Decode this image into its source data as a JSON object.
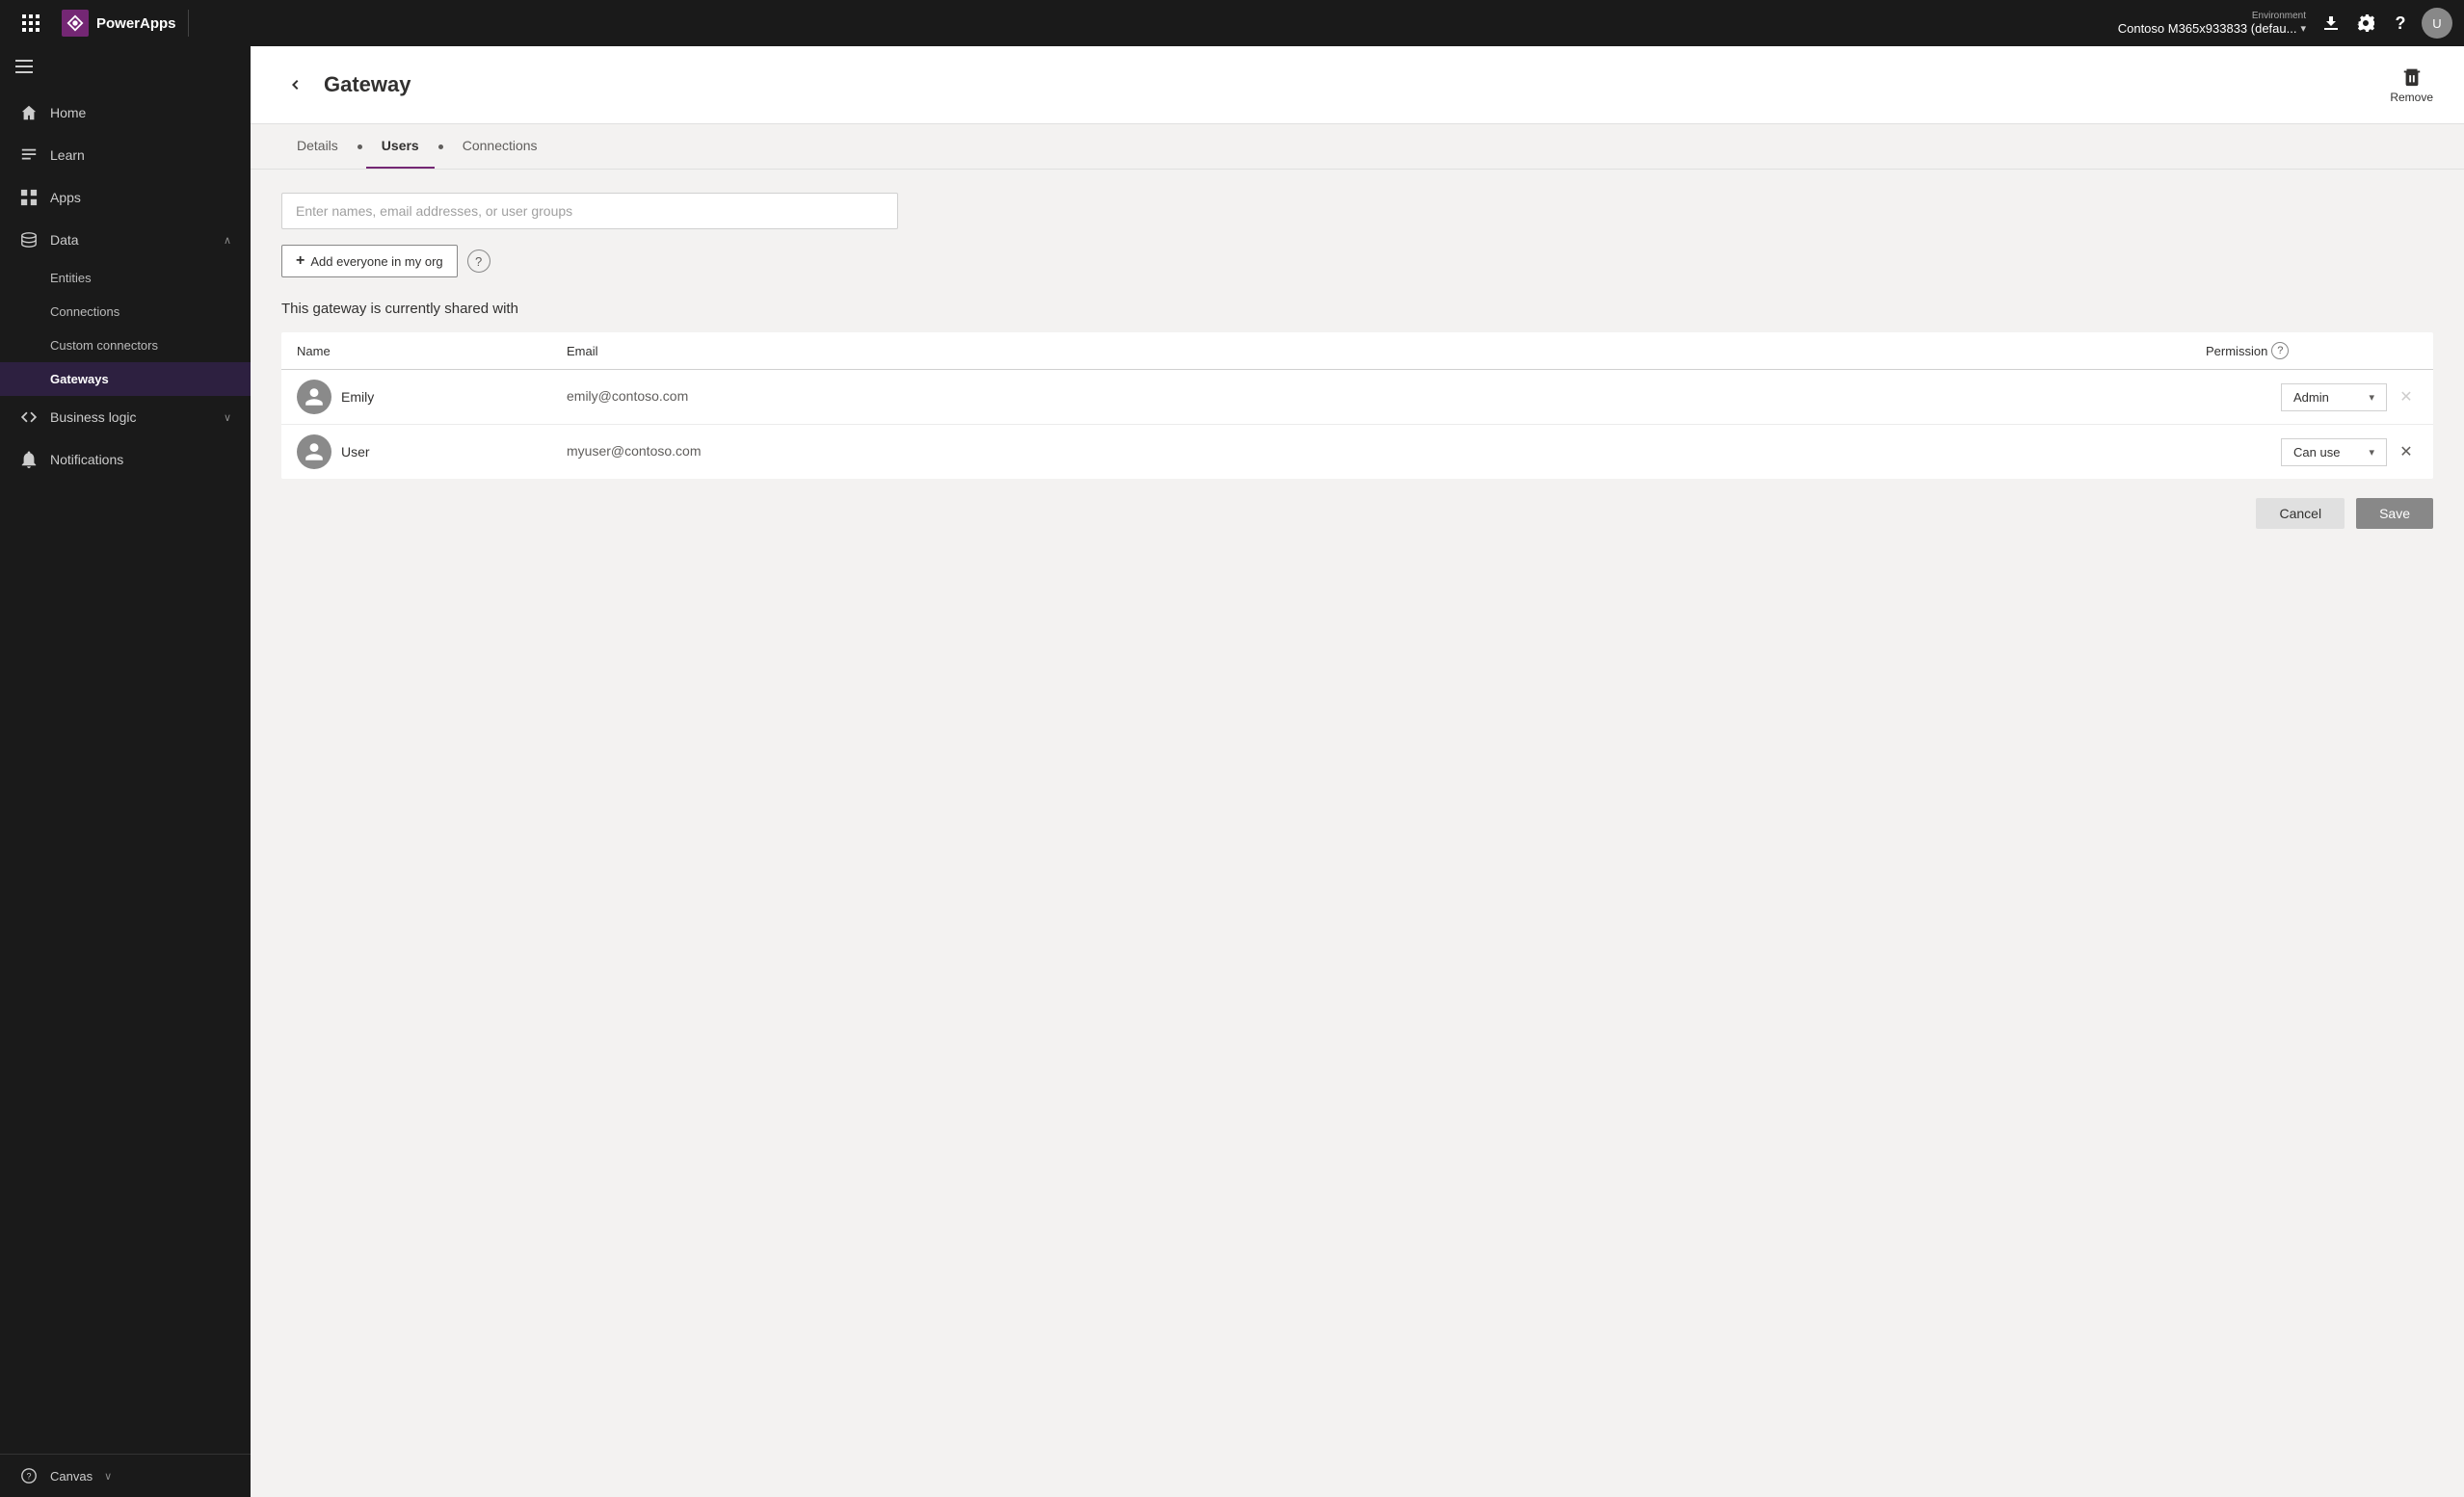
{
  "topbar": {
    "logo_title": "PowerApps",
    "env_label": "Environment",
    "env_value": "Contoso M365x933833 (defau...",
    "download_icon": "download-icon",
    "settings_icon": "settings-icon",
    "help_icon": "help-icon",
    "avatar_label": "U"
  },
  "sidebar": {
    "hamburger_icon": "hamburger-icon",
    "items": [
      {
        "id": "home",
        "label": "Home",
        "icon": "home-icon",
        "expandable": false
      },
      {
        "id": "learn",
        "label": "Learn",
        "icon": "learn-icon",
        "expandable": false
      },
      {
        "id": "apps",
        "label": "Apps",
        "icon": "apps-icon",
        "expandable": false
      },
      {
        "id": "data",
        "label": "Data",
        "icon": "data-icon",
        "expandable": true,
        "expanded": true
      }
    ],
    "sub_items": [
      {
        "id": "entities",
        "label": "Entities"
      },
      {
        "id": "connections",
        "label": "Connections"
      },
      {
        "id": "custom-connectors",
        "label": "Custom connectors"
      },
      {
        "id": "gateways",
        "label": "Gateways",
        "active": true
      }
    ],
    "bottom_items": [
      {
        "id": "business-logic",
        "label": "Business logic",
        "icon": "code-icon",
        "expandable": true
      },
      {
        "id": "notifications",
        "label": "Notifications",
        "icon": "bell-icon",
        "expandable": false
      }
    ],
    "footer": {
      "label": "Canvas",
      "icon": "canvas-icon"
    }
  },
  "page": {
    "back_icon": "back-icon",
    "title": "Gateway",
    "remove_label": "Remove",
    "remove_icon": "trash-icon"
  },
  "tabs": [
    {
      "id": "details",
      "label": "Details",
      "active": false
    },
    {
      "id": "users",
      "label": "Users",
      "active": true
    },
    {
      "id": "connections",
      "label": "Connections",
      "active": false
    }
  ],
  "users_tab": {
    "search_placeholder": "Enter names, email addresses, or user groups",
    "add_btn_label": "Add everyone in my org",
    "help_icon": "help-circle-icon",
    "shared_label": "This gateway is currently shared with",
    "table": {
      "col_name": "Name",
      "col_email": "Email",
      "col_permission": "Permission",
      "perm_help_icon": "permission-help-icon",
      "rows": [
        {
          "id": "emily",
          "name": "Emily",
          "email": "emily@contoso.com",
          "permission": "Admin",
          "removable": false
        },
        {
          "id": "user",
          "name": "User",
          "email": "myuser@contoso.com",
          "permission": "Can use",
          "removable": true
        }
      ]
    },
    "cancel_label": "Cancel",
    "save_label": "Save"
  }
}
